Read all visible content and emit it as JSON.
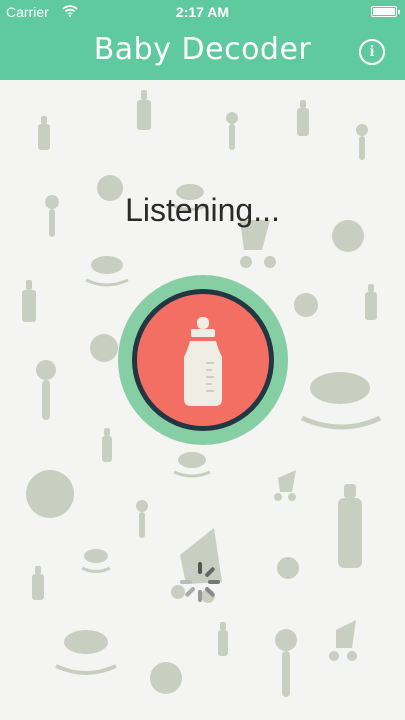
{
  "status_bar": {
    "carrier": "Carrier",
    "time": "2:17 AM"
  },
  "nav": {
    "title": "Baby Decoder",
    "info_icon_glyph": "i"
  },
  "main": {
    "status_text": "Listening...",
    "record_button_icon": "baby-bottle-icon"
  },
  "colors": {
    "accent": "#5fc9a0",
    "button_outer": "#86cea3",
    "button_ring": "#233743",
    "button_fill": "#f46f63",
    "pattern": "#c8cfc0"
  }
}
